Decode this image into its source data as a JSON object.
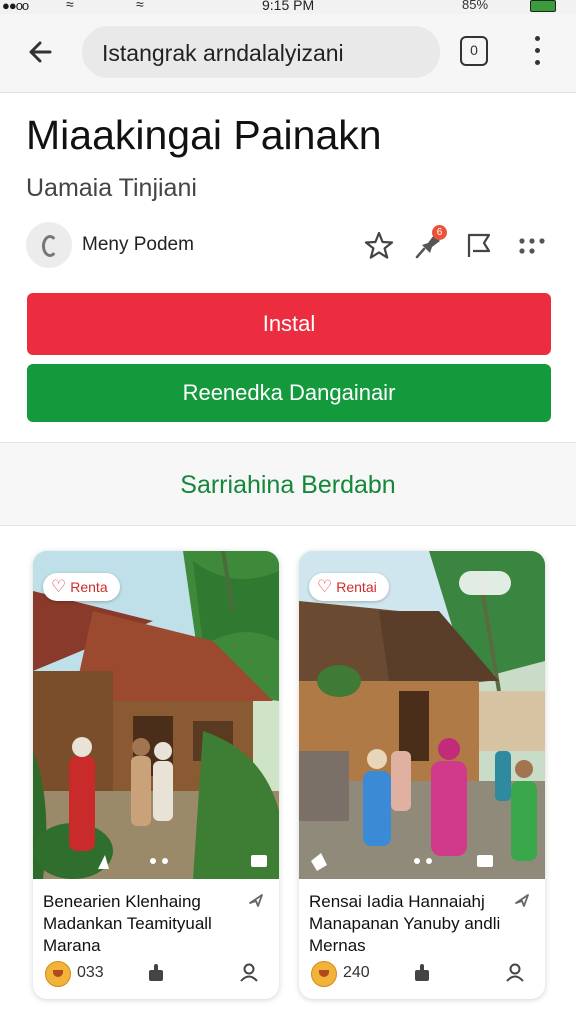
{
  "status_bar": {
    "left": "●●oo",
    "time": "9:15 PM",
    "battery": "85%"
  },
  "app_bar": {
    "address": "Istangrak arndalalyizani",
    "tabs_count": "0"
  },
  "app": {
    "title": "Miaakingai Painakn",
    "subtitle": "Uamaia Tinjiani",
    "developer": "Meny Podem",
    "notification_count": "6",
    "install_label": "Instal",
    "secondary_label": "Reenedka Dangainair"
  },
  "section": {
    "title": "Sarriahina Berdabn"
  },
  "cards": [
    {
      "tag": "Renta",
      "title": "Benearien Klenhaing Madankan Teamityuall Marana",
      "count": "033"
    },
    {
      "tag": "Rentai",
      "title": "Rensai Iadia Hannaiahj Manapanan Yanuby andli Mernas",
      "count": "240"
    }
  ],
  "colors": {
    "install": "#eb2d3f",
    "secondary": "#149a3c",
    "section_title": "#14873a"
  },
  "icons": [
    "back-arrow-icon",
    "tabs-icon",
    "more-vert-icon",
    "developer-icon",
    "star-icon",
    "pin-icon",
    "flag-icon",
    "more-horiz-icon",
    "heart-icon",
    "share-icon",
    "like-icon",
    "user-icon"
  ]
}
